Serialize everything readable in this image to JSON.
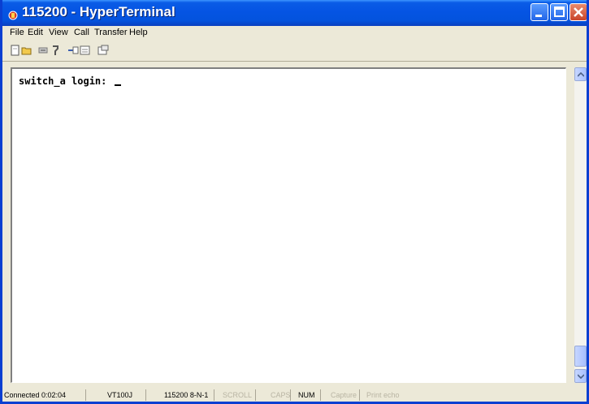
{
  "window": {
    "title": "115200 - HyperTerminal",
    "icons": {
      "app": "hyperterminal-icon",
      "minimize": "minimize-icon",
      "maximize": "maximize-icon",
      "close": "close-icon"
    }
  },
  "menu": {
    "file": "File",
    "edit": "Edit",
    "view": "View",
    "call": "Call",
    "transfer": "Transfer",
    "help": "Help"
  },
  "toolbar": {
    "icons": [
      "new-icon",
      "open-icon",
      "connect-icon",
      "disconnect-icon",
      "send-icon",
      "receive-icon",
      "properties-icon"
    ]
  },
  "terminal": {
    "line1": "switch_a login: "
  },
  "status": {
    "connected": "Connected 0:02:04",
    "emulation": "VT100J",
    "settings": "115200 8-N-1",
    "scroll": "SCROLL",
    "caps": "CAPS",
    "num": "NUM",
    "capture": "Capture",
    "print_echo": "Print echo"
  },
  "colors": {
    "titlebar": "#0554e3",
    "window_bg": "#ece9d8",
    "terminal_bg": "#ffffff",
    "close_button": "#c9452a"
  }
}
